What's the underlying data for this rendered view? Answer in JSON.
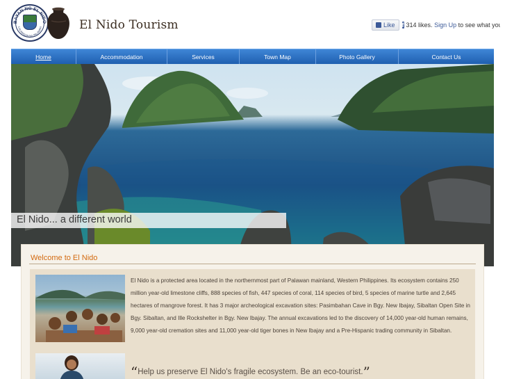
{
  "header": {
    "seal_text": "BAYAN NG EL NIDO",
    "seal_subtext": "LALAWIGAN NG PALAWAN",
    "site_title": "El Nido Tourism"
  },
  "facebook": {
    "like_label": "Like",
    "likes_text": "314 likes.",
    "signup_link": "Sign Up",
    "signup_rest": "to see what your fr"
  },
  "nav": {
    "items": [
      {
        "label": "Home",
        "active": true
      },
      {
        "label": "Accommodation"
      },
      {
        "label": "Services"
      },
      {
        "label": "Town Map"
      },
      {
        "label": "Photo Gallery"
      },
      {
        "label": "Contact Us"
      }
    ]
  },
  "hero": {
    "tagline": "El Nido... a different world"
  },
  "main": {
    "heading": "Welcome to El Nido",
    "description": "El Nido is a protected area located in the northernmost part of Palawan mainland, Western Philippines. Its ecosystem contains 250 million year-old limestone cliffs, 888 species of fish, 447 species of coral, 114 species of bird, 5 species of marine turtle and 2,645 hectares of mangrove forest. It has 3 major archeological excavation sites: Pasimbahan Cave in Bgy. New Ibajay, Sibaltan Open Site in Bgy. Sibaltan, and Ille Rockshelter in Bgy. New Ibajay. The annual excavations led to the discovery of 14,000 year-old human remains, 9,000 year-old cremation sites and 11,000 year-old tiger bones in New Ibajay and a Pre-Hispanic trading community in Sibaltan.",
    "quote": "Help us preserve El Nido's fragile ecosystem. Be an eco-tourist.",
    "quote_open": "“",
    "quote_close": "”"
  },
  "colors": {
    "nav_blue": "#2a6cc0",
    "heading_orange": "#d36a10",
    "panel_beige": "#e9dfcd"
  }
}
